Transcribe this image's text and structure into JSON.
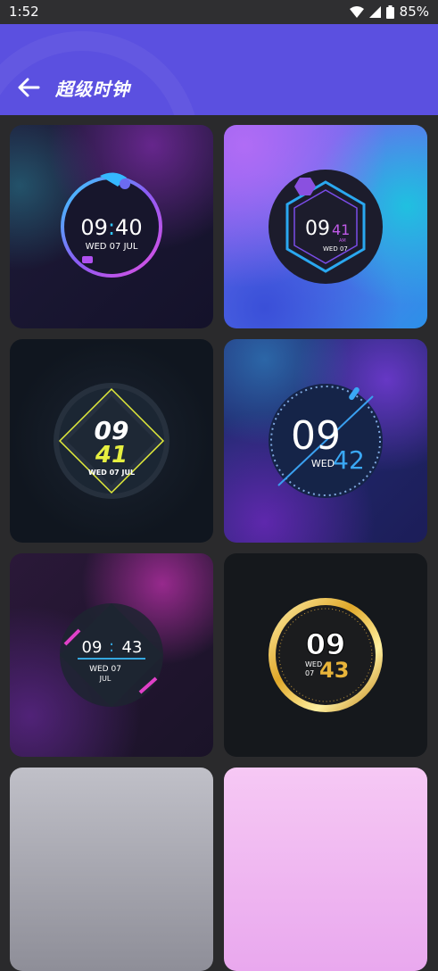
{
  "status_bar": {
    "time": "1:52",
    "battery": "85%"
  },
  "app_bar": {
    "title": "超级时钟",
    "back_icon": "arrow-left-icon",
    "color": "#5b50e0"
  },
  "watch_faces": [
    {
      "hour": "09",
      "colon": ":",
      "minute": "40",
      "day": "WED",
      "date": "07",
      "month": "JUL"
    },
    {
      "hour": "09",
      "minute": "41",
      "ampm": "AM",
      "day": "WED",
      "date": "07"
    },
    {
      "hour": "09",
      "minute": "41",
      "day": "WED",
      "date": "07",
      "month": "JUL"
    },
    {
      "hour": "09",
      "minute": "42",
      "day": "WED"
    },
    {
      "hour": "09",
      "colon": ":",
      "minute": "43",
      "day": "WED",
      "date": "07",
      "month": "JUL"
    },
    {
      "hour": "09",
      "minute": "43",
      "day": "WED",
      "date": "07"
    }
  ]
}
